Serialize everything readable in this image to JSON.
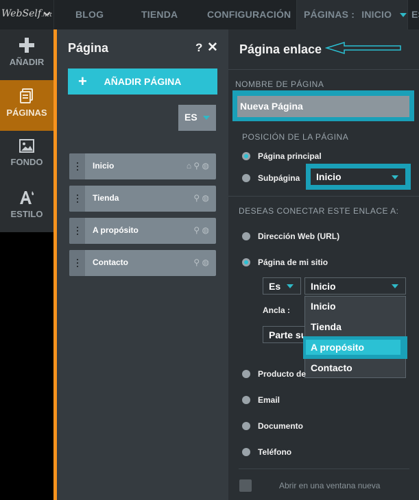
{
  "topbar": {
    "logo": {
      "main": "WebSelf",
      "suffix": ".net"
    },
    "nav": {
      "blog": "BLOG",
      "store": "TIENDA",
      "config": "CONFIGURACIÓN",
      "pages_label": "PÁGINAS :",
      "pages_value": "INICIO",
      "cut": "ES"
    }
  },
  "rail": {
    "items": [
      {
        "label": "AÑADIR",
        "icon": "plus-icon"
      },
      {
        "label": "PÁGINAS",
        "icon": "pages-icon",
        "active": true
      },
      {
        "label": "FONDO",
        "icon": "image-icon"
      },
      {
        "label": "ESTILO",
        "icon": "style-icon"
      }
    ]
  },
  "pages_panel": {
    "title": "Página",
    "help": "?",
    "close": "✕",
    "add_button": "AÑADIR PÁGINA",
    "add_plus": "+",
    "lang": "ES",
    "pages": [
      {
        "label": "Inicio",
        "icons": "⌂ ⚲ ◍"
      },
      {
        "label": "Tienda",
        "icons": "⚲ ◍"
      },
      {
        "label": "A propósito",
        "icons": "⚲ ◍"
      },
      {
        "label": "Contacto",
        "icons": "⚲ ◍"
      }
    ]
  },
  "link_panel": {
    "title": "Página enlace",
    "name_section": "NOMBRE DE PÁGINA",
    "name_value": "Nueva Página",
    "position_section": "POSICIÓN DE LA PÁGINA",
    "position_main": "Página principal",
    "position_sub": "Subpágina",
    "sub_select": "Inicio",
    "connect_section": "DESEAS CONECTAR ESTE ENLACE A:",
    "options": {
      "url": "Dirección Web (URL)",
      "mysite": "Página de mi sitio",
      "product": "Producto de",
      "email": "Email",
      "document": "Documento",
      "phone": "Teléfono"
    },
    "lang_select": "Es",
    "page_select": "Inicio",
    "anchor_label": "Ancla :",
    "anchor_value": "Parte su",
    "dropdown": [
      "Inicio",
      "Tienda",
      "A propósito",
      "Contacto"
    ],
    "dropdown_highlight": "A propósito",
    "new_window": "Abrir en una ventana nueva"
  },
  "colors": {
    "accent": "#2bc1d4",
    "rail_active": "#b06a0c",
    "orange": "#f7931e"
  }
}
